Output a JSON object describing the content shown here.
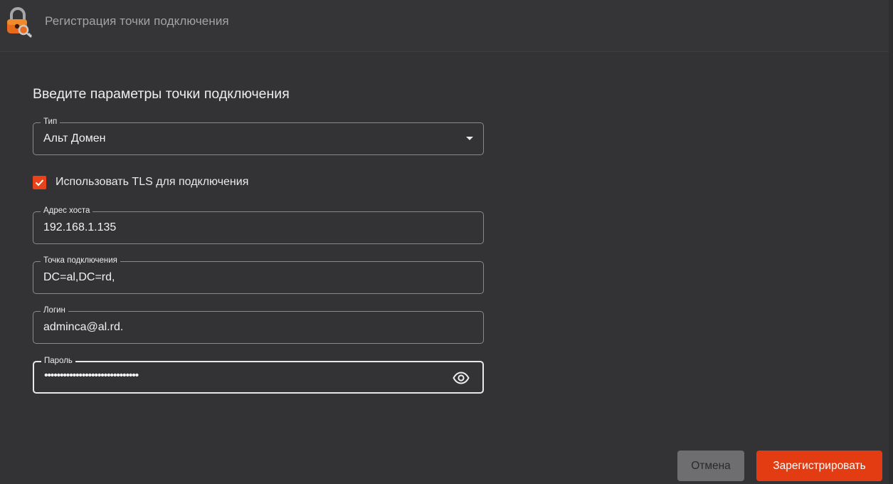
{
  "window": {
    "title": "Регистрация точки подключения",
    "logo_icon": "lock-key-logo-icon"
  },
  "form": {
    "heading": "Введите параметры точки подключения",
    "type": {
      "label": "Тип",
      "value": "Альт Домен",
      "icon": "dropdown-arrow-icon"
    },
    "tls": {
      "label": "Использовать TLS для подключения",
      "checked": true
    },
    "host": {
      "label": "Адрес хоста",
      "value": "192.168.1.135"
    },
    "endpoint": {
      "label": "Точка подключения",
      "value": "DC=al,DC=rd,"
    },
    "login": {
      "label": "Логин",
      "value": "adminca@al.rd."
    },
    "password": {
      "label": "Пароль",
      "masked_value": "••••••••••••••••••••••••••••••",
      "icon": "eye-icon"
    }
  },
  "buttons": {
    "cancel": "Отмена",
    "register": "Зарегистрировать"
  },
  "colors": {
    "background": "#333335",
    "accent": "#e43c12",
    "checkbox": "#e8421b",
    "cancel_button": "#6e6e70"
  }
}
